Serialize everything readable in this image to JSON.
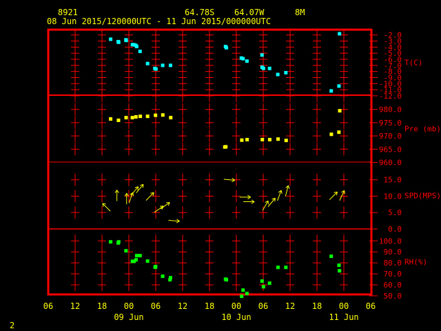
{
  "header": {
    "station": "8921",
    "lat": "64.78S",
    "lon": "64.07W",
    "elev": "8M",
    "period": "08 Jun 2015/120000UTC - 11 Jun 2015/000000UTC"
  },
  "footer": {
    "page": "2"
  },
  "colors": {
    "frame": "#ff0000",
    "text": "#ffff00",
    "temp": "#00ffff",
    "pressure": "#ffff00",
    "wind": "#ffff00",
    "rh": "#00ff00"
  },
  "chart_data": {
    "type": "scatter",
    "x_axis": {
      "range": [
        "2015-06-08T06:00",
        "2015-06-11T06:00"
      ],
      "tick_labels": [
        "06",
        "12",
        "18",
        "00",
        "06",
        "12",
        "18",
        "00",
        "06",
        "12",
        "18",
        "00",
        "06"
      ],
      "date_labels": [
        {
          "label": "09 Jun",
          "at": "2015-06-09T00:00"
        },
        {
          "label": "10 Jun",
          "at": "2015-06-10T00:00"
        },
        {
          "label": "11 Jun",
          "at": "2015-06-11T00:00"
        }
      ]
    },
    "panels": [
      {
        "id": "temp",
        "ylabel": "T(C)",
        "ylim": [
          -12,
          -2
        ],
        "ticks": [
          "-2.0",
          "-3.0",
          "-4.0",
          "-5.0",
          "-6.0",
          "-7.0",
          "-8.0",
          "-9.0",
          "-10.0",
          "-11.0",
          "-12.0"
        ],
        "points": [
          [
            "2015-06-08T19:56",
            -2.7
          ],
          [
            "2015-06-08T21:37",
            -3.1
          ],
          [
            "2015-06-08T21:44",
            -3.2
          ],
          [
            "2015-06-08T23:20",
            -2.8
          ],
          [
            "2015-06-08T23:25",
            -2.9
          ],
          [
            "2015-06-09T00:48",
            -3.6
          ],
          [
            "2015-06-09T01:07",
            -3.6
          ],
          [
            "2015-06-09T01:33",
            -3.7
          ],
          [
            "2015-06-09T01:45",
            -3.9
          ],
          [
            "2015-06-09T02:30",
            -4.7
          ],
          [
            "2015-06-09T04:11",
            -6.7
          ],
          [
            "2015-06-09T05:48",
            -7.5
          ],
          [
            "2015-06-09T06:03",
            -7.6
          ],
          [
            "2015-06-09T07:33",
            -7.0
          ],
          [
            "2015-06-09T09:18",
            -7.0
          ],
          [
            "2015-06-09T21:35",
            -3.9
          ],
          [
            "2015-06-09T21:47",
            -4.1
          ],
          [
            "2015-06-10T01:07",
            -5.8
          ],
          [
            "2015-06-10T01:30",
            -5.9
          ],
          [
            "2015-06-10T02:22",
            -6.3
          ],
          [
            "2015-06-10T05:44",
            -5.3
          ],
          [
            "2015-06-10T05:44",
            -7.3
          ],
          [
            "2015-06-10T06:03",
            -7.5
          ],
          [
            "2015-06-10T07:25",
            -7.5
          ],
          [
            "2015-06-10T09:15",
            -8.5
          ],
          [
            "2015-06-10T11:03",
            -8.2
          ],
          [
            "2015-06-10T21:11",
            -11.2
          ],
          [
            "2015-06-10T22:55",
            -10.4
          ],
          [
            "2015-06-10T23:02",
            -1.8
          ]
        ]
      },
      {
        "id": "pressure",
        "ylabel": "Pre (mb)",
        "ylim": [
          960,
          980
        ],
        "ticks": [
          "980.0",
          "975.0",
          "970.0",
          "965.0",
          "960.0"
        ],
        "points": [
          [
            "2015-06-08T19:56",
            976.4
          ],
          [
            "2015-06-08T21:41",
            975.9
          ],
          [
            "2015-06-08T23:23",
            976.9
          ],
          [
            "2015-06-09T00:47",
            976.9
          ],
          [
            "2015-06-09T01:35",
            977.2
          ],
          [
            "2015-06-09T02:33",
            977.4
          ],
          [
            "2015-06-09T04:11",
            977.4
          ],
          [
            "2015-06-09T05:57",
            977.8
          ],
          [
            "2015-06-09T07:35",
            977.9
          ],
          [
            "2015-06-09T09:21",
            976.9
          ],
          [
            "2015-06-09T21:25",
            965.8
          ],
          [
            "2015-06-09T21:39",
            965.9
          ],
          [
            "2015-06-10T01:13",
            968.4
          ],
          [
            "2015-06-10T02:24",
            968.6
          ],
          [
            "2015-06-10T05:48",
            968.6
          ],
          [
            "2015-06-10T07:27",
            968.6
          ],
          [
            "2015-06-10T09:19",
            968.8
          ],
          [
            "2015-06-10T11:07",
            968.3
          ],
          [
            "2015-06-10T21:13",
            970.6
          ],
          [
            "2015-06-10T22:54",
            971.4
          ],
          [
            "2015-06-10T23:05",
            979.5
          ]
        ]
      },
      {
        "id": "wind",
        "ylabel": "SPD(MPS)",
        "ylim": [
          0,
          15
        ],
        "ticks": [
          "15.0",
          "10.0",
          "5.0",
          "0.0"
        ],
        "arrow_fields": [
          "time",
          "speed_mps",
          "toward_deg"
        ],
        "points": [
          [
            "2015-06-08T19:00",
            6.6,
            315
          ],
          [
            "2015-06-08T21:20",
            10.2,
            0
          ],
          [
            "2015-06-08T23:30",
            9.2,
            0
          ],
          [
            "2015-06-09T00:27",
            9.5,
            20
          ],
          [
            "2015-06-09T01:18",
            11.6,
            40
          ],
          [
            "2015-06-09T02:26",
            12.3,
            40
          ],
          [
            "2015-06-09T04:42",
            9.9,
            45
          ],
          [
            "2015-06-09T06:41",
            6.0,
            55
          ],
          [
            "2015-06-09T08:06",
            7.1,
            55
          ],
          [
            "2015-06-09T10:05",
            2.5,
            95
          ],
          [
            "2015-06-09T22:26",
            15.0,
            95
          ],
          [
            "2015-06-10T01:57",
            9.7,
            90
          ],
          [
            "2015-06-10T02:47",
            8.3,
            90
          ],
          [
            "2015-06-10T06:29",
            7.1,
            30
          ],
          [
            "2015-06-10T07:53",
            8.1,
            40
          ],
          [
            "2015-06-10T09:36",
            10.2,
            20
          ],
          [
            "2015-06-10T11:17",
            11.6,
            15
          ],
          [
            "2015-06-10T21:40",
            10.1,
            45
          ],
          [
            "2015-06-10T23:35",
            10.2,
            25
          ]
        ]
      },
      {
        "id": "rh",
        "ylabel": "RH(%)",
        "ylim": [
          50,
          100
        ],
        "ticks": [
          "100.0",
          "90.0",
          "80.0",
          "70.0",
          "60.0",
          "50.0"
        ],
        "points": [
          [
            "2015-06-08T19:56",
            99.1
          ],
          [
            "2015-06-08T21:37",
            98.1
          ],
          [
            "2015-06-08T21:44",
            99.1
          ],
          [
            "2015-06-08T23:22",
            91.0
          ],
          [
            "2015-06-09T00:48",
            81.4
          ],
          [
            "2015-06-09T01:11",
            81.4
          ],
          [
            "2015-06-09T01:37",
            82.8
          ],
          [
            "2015-06-09T01:45",
            86.6
          ],
          [
            "2015-06-09T02:30",
            86.6
          ],
          [
            "2015-06-09T04:11",
            81.6
          ],
          [
            "2015-06-09T05:52",
            76.0
          ],
          [
            "2015-06-09T05:59",
            76.6
          ],
          [
            "2015-06-09T07:33",
            67.8
          ],
          [
            "2015-06-09T09:18",
            66.5
          ],
          [
            "2015-06-09T09:11",
            64.6
          ],
          [
            "2015-06-09T21:35",
            65.2
          ],
          [
            "2015-06-09T21:47",
            64.6
          ],
          [
            "2015-06-10T01:11",
            49.6
          ],
          [
            "2015-06-10T01:30",
            55.2
          ],
          [
            "2015-06-10T02:22",
            52.1
          ],
          [
            "2015-06-10T05:44",
            63.4
          ],
          [
            "2015-06-10T06:03",
            58.3
          ],
          [
            "2015-06-10T07:25",
            61.5
          ],
          [
            "2015-06-10T09:18",
            75.9
          ],
          [
            "2015-06-10T11:03",
            75.9
          ],
          [
            "2015-06-10T21:11",
            86.0
          ],
          [
            "2015-06-10T22:55",
            77.8
          ],
          [
            "2015-06-10T23:02",
            72.8
          ]
        ]
      }
    ]
  }
}
